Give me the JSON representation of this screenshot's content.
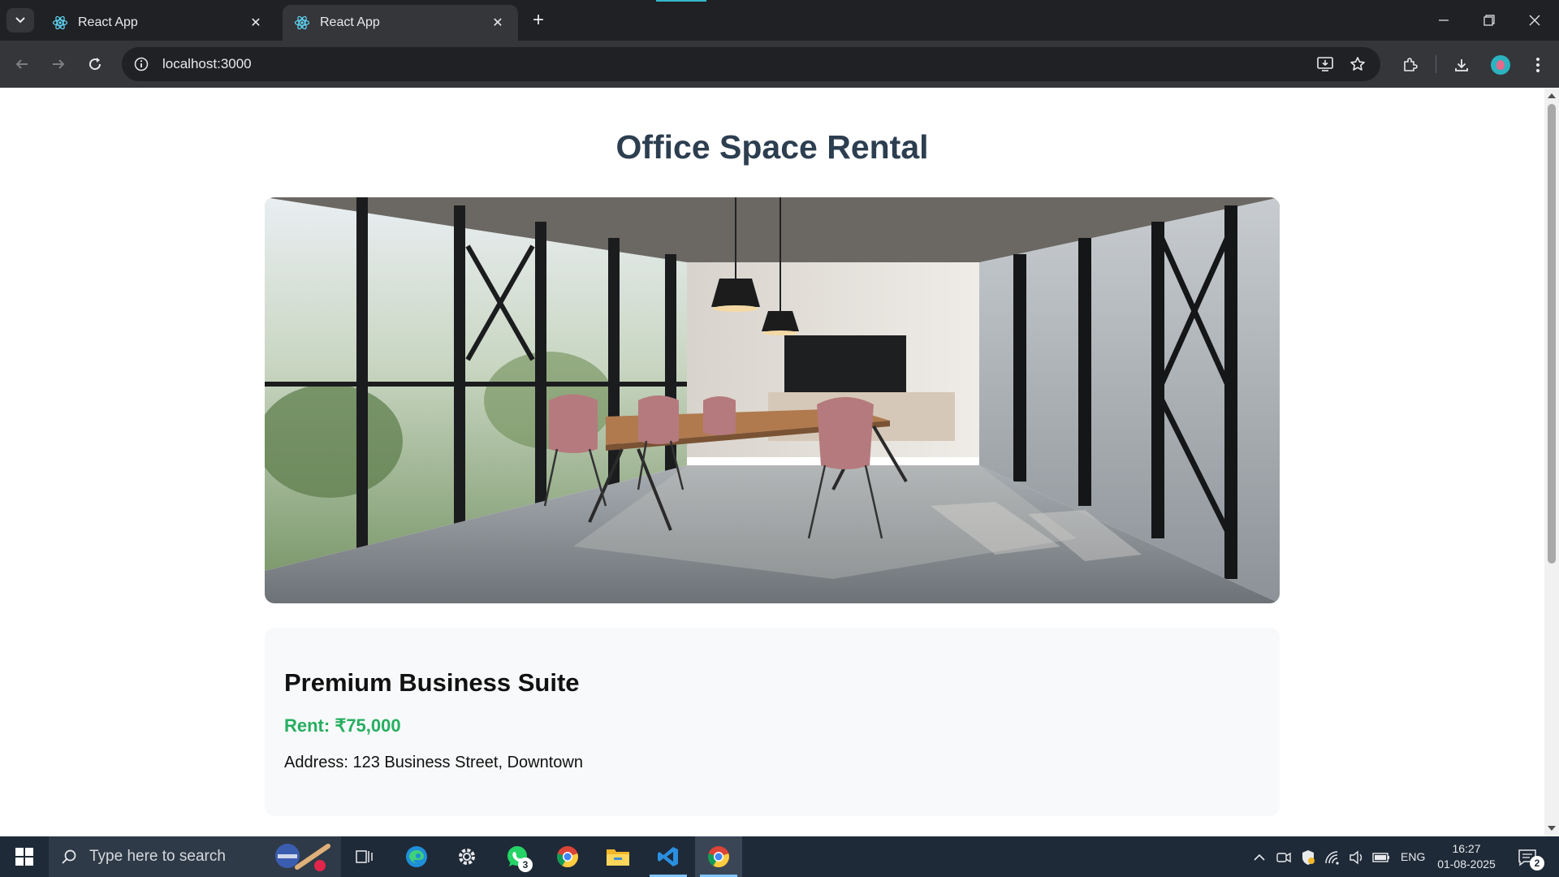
{
  "browser": {
    "tabs": [
      {
        "title": "React App",
        "active": false
      },
      {
        "title": "React App",
        "active": true
      }
    ],
    "url": "localhost:3000"
  },
  "page": {
    "title": "Office Space Rental",
    "hero_image": "office-interior-photo",
    "card": {
      "name": "Premium Business Suite",
      "rent": "Rent: ₹75,000",
      "address": "Address: 123 Business Street, Downtown"
    },
    "colors": {
      "title": "#2c3e50",
      "rent": "#27ae60",
      "card_bg": "#f8f9fa"
    }
  },
  "taskbar": {
    "search_placeholder": "Type here to search",
    "apps": [
      {
        "name": "task-view",
        "active": false
      },
      {
        "name": "edge",
        "active": false
      },
      {
        "name": "settings",
        "active": false
      },
      {
        "name": "whatsapp",
        "active": false,
        "badge": "3"
      },
      {
        "name": "chrome",
        "active": false
      },
      {
        "name": "file-explorer",
        "active": false
      },
      {
        "name": "vscode",
        "active": false,
        "running": true
      },
      {
        "name": "chrome-active",
        "active": true
      }
    ],
    "tray": {
      "language": "ENG"
    },
    "clock": {
      "time": "16:27",
      "date": "01-08-2025"
    },
    "notifications": "2"
  }
}
